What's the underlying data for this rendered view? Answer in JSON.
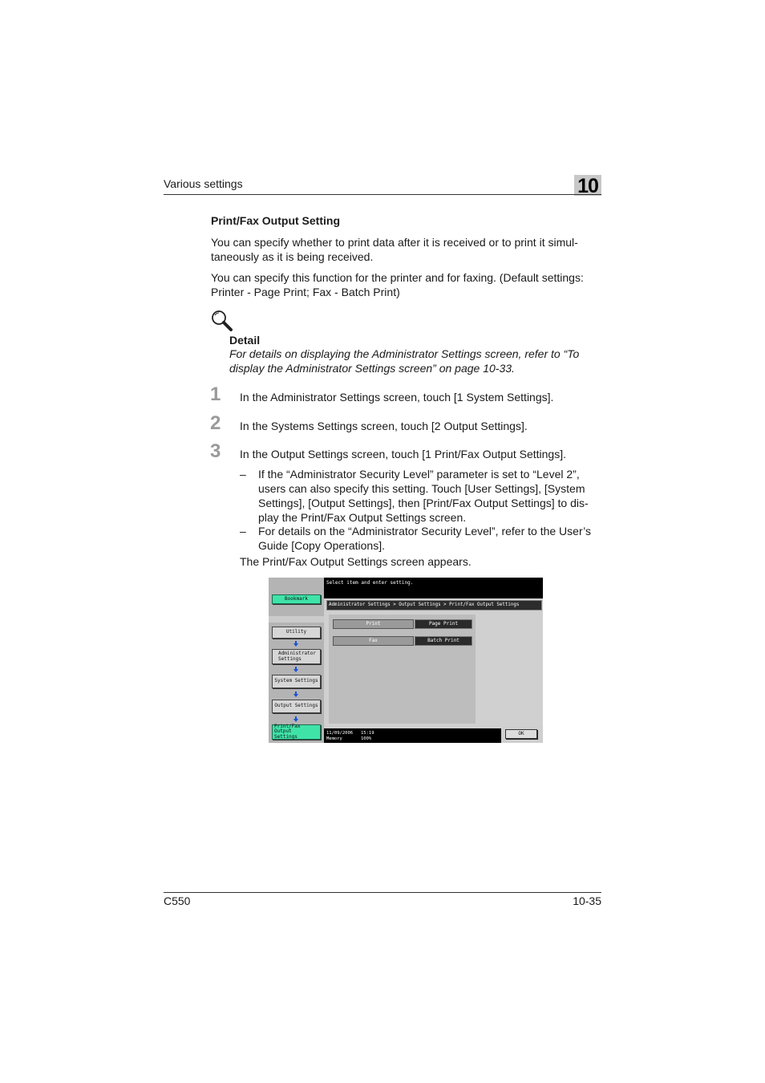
{
  "header": {
    "section_title": "Various settings",
    "chapter_number": "10"
  },
  "section": {
    "heading": "Print/Fax Output Setting",
    "paragraphs": [
      "You can specify whether to print data after it is received or to print it simul-",
      "taneously as it is being received.",
      "You can specify this function for the printer and for faxing. (Default settings:",
      "Printer - Page Print; Fax - Batch Print)"
    ]
  },
  "detail": {
    "title": "Detail",
    "text_lines": [
      "For details on displaying the Administrator Settings screen, refer to “To",
      "display the Administrator Settings screen” on page 10-33."
    ]
  },
  "steps": [
    {
      "number": "1",
      "text": "In the Administrator Settings screen, touch [1 System Settings]."
    },
    {
      "number": "2",
      "text": "In the Systems Settings screen, touch [2 Output Settings]."
    },
    {
      "number": "3",
      "text": "In the Output Settings screen, touch [1 Print/Fax Output Settings]."
    }
  ],
  "bullets": [
    {
      "dash": "–",
      "lines": [
        "If the “Administrator Security Level” parameter is set to “Level 2”,",
        "users can also specify this setting. Touch [User Settings], [System",
        "Settings], [Output Settings], then [Print/Fax Output Settings] to dis-",
        "play the Print/Fax Output Settings screen."
      ]
    },
    {
      "dash": "–",
      "lines": [
        "For details on the “Administrator Security Level”, refer to the User’s",
        "Guide [Copy Operations]."
      ]
    }
  ],
  "result_text": "The Print/Fax Output Settings screen appears.",
  "screen": {
    "instruction": "Select item and enter setting.",
    "breadcrumb": "Administrator Settings > Output Settings > Print/Fax Output Settings",
    "sidebar": {
      "bookmark": "Bookmark",
      "utility": "Utility",
      "admin_line1": "Administrator",
      "admin_line2": "Settings",
      "system_settings": "System Settings",
      "output_settings": "Output Settings",
      "current_line1": "Print/Fax Output",
      "current_line2": "Settings"
    },
    "rows": [
      {
        "label": "Print",
        "value": "Page Print"
      },
      {
        "label": "Fax",
        "value": "Batch Print"
      }
    ],
    "status": {
      "date": "11/09/2006",
      "time": "15:19",
      "memory_label": "Memory",
      "memory_value": "100%"
    },
    "ok_label": "OK",
    "colors": {
      "active_green": "#3fe3a8",
      "value_bg": "#2a2a2a"
    }
  },
  "footer": {
    "model": "C550",
    "page": "10-35"
  }
}
